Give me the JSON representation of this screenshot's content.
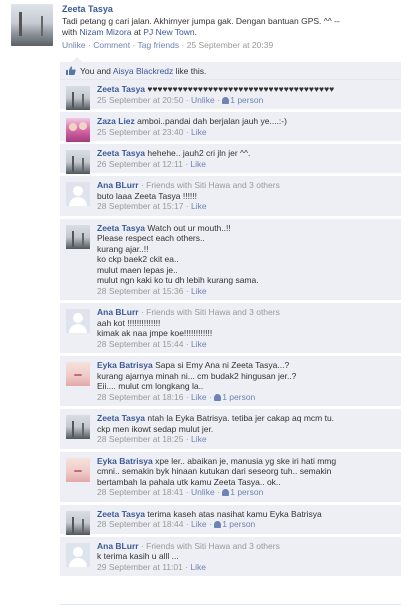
{
  "post": {
    "author": "Zeeta Tasya",
    "text": "Tadi petang g cari jalan. Akhirnyer jumpa gak. Dengan bantuan GPS. ^^ --",
    "with_prefix": "with",
    "with_name": "Nizam Mizora",
    "at_prefix": "at",
    "place": "PJ New Town",
    "period": ".",
    "actions": {
      "unlike": "Unlike",
      "comment": "Comment",
      "tag": "Tag friends"
    },
    "sep": "·",
    "time": "25 September at 20:39"
  },
  "likes": {
    "you": "You",
    "and": "and",
    "name": "Aisya Blackredz",
    "suffix": "like this."
  },
  "comments": [
    {
      "author": "Zeeta Tasya",
      "avatar": "tower",
      "friends": "",
      "lines": [
        "♥♥♥♥♥♥♥♥♥♥♥♥♥♥♥♥♥♥♥♥♥♥♥♥♥♥♥♥♥♥♥♥♥♥♥♥♥"
      ],
      "time": "25 September at 20:50",
      "action": "Unlike",
      "count": "1 person"
    },
    {
      "author": "Zaza Liez",
      "avatar": "pink",
      "friends": "",
      "lines": [
        "amboi..pandai dah berjalan jauh ye....:-)"
      ],
      "time": "25 September at 23:40",
      "action": "Like",
      "count": ""
    },
    {
      "author": "Zeeta Tasya",
      "avatar": "tower",
      "friends": "",
      "lines": [
        "hehehe.. jauh2 cri jln jer ^^."
      ],
      "time": "26 September at 12:11",
      "action": "Like",
      "count": ""
    },
    {
      "author": "Ana BLurr",
      "avatar": "blank",
      "friends": "Friends with Siti Hawa and 3 others",
      "lines": [
        "buto laaa Zeeta Tasya !!!!!!"
      ],
      "time": "28 September at 15:17",
      "action": "Like",
      "count": ""
    },
    {
      "author": "Zeeta Tasya",
      "avatar": "tower",
      "friends": "",
      "lines": [
        "Watch out ur mouth..!!",
        "Please respect each others..",
        "kurang ajar..!!",
        "ko ckp baek2 ckit ea..",
        "mulut maen lepas je..",
        "mulut ngn kaki ko tu dh lebih kurang sama."
      ],
      "time": "28 September at 15:36",
      "action": "Like",
      "count": ""
    },
    {
      "author": "Ana BLurr",
      "avatar": "blank",
      "friends": "Friends with Siti Hawa and 3 others",
      "lines": [
        "aah kot !!!!!!!!!!!!!!",
        "kimak ak naa jmpe koe!!!!!!!!!!!!"
      ],
      "time": "28 September at 15:44",
      "action": "Like",
      "count": ""
    },
    {
      "author": "Eyka Batrisya",
      "avatar": "face",
      "friends": "",
      "lines": [
        "Sapa si Emy Ana ni Zeeta Tasya...?",
        "kurang ajarnya minah ni... cm budak2 hingusan jer..?",
        "Eii.... mulut cm longkang la.."
      ],
      "time": "28 September at 18:16",
      "action": "Like",
      "count": "1 person"
    },
    {
      "author": "Zeeta Tasya",
      "avatar": "tower",
      "friends": "",
      "lines": [
        "ntah la Eyka Batrisya. tetiba jer cakap aq mcm tu.",
        "ckp men ikowt sedap mulut jer."
      ],
      "time": "28 September at 18:25",
      "action": "Like",
      "count": ""
    },
    {
      "author": "Eyka Batrisya",
      "avatar": "face",
      "friends": "",
      "lines": [
        "xpe ler.. abaikan je, manusia yg ske iri hati mmg",
        "cmni.. semakin byk hinaan kutukan dari seseorg tuh.. semakin",
        "bertambah la pahala utk kamu Zeeta Tasya.. ok.."
      ],
      "time": "28 September at 18:41",
      "action": "Unlike",
      "count": "1 person"
    },
    {
      "author": "Zeeta Tasya",
      "avatar": "tower",
      "friends": "",
      "lines": [
        "terima kaseh atas nasihat kamu Eyka Batrisya"
      ],
      "time": "28 September at 18:44",
      "action": "Like",
      "count": "1 person"
    },
    {
      "author": "Ana BLurr",
      "avatar": "blank",
      "friends": "Friends with Siti Hawa and 3 others",
      "lines": [
        "k terima kasih u alll ..."
      ],
      "time": "29 September at 11:01",
      "action": "Like",
      "count": ""
    }
  ]
}
